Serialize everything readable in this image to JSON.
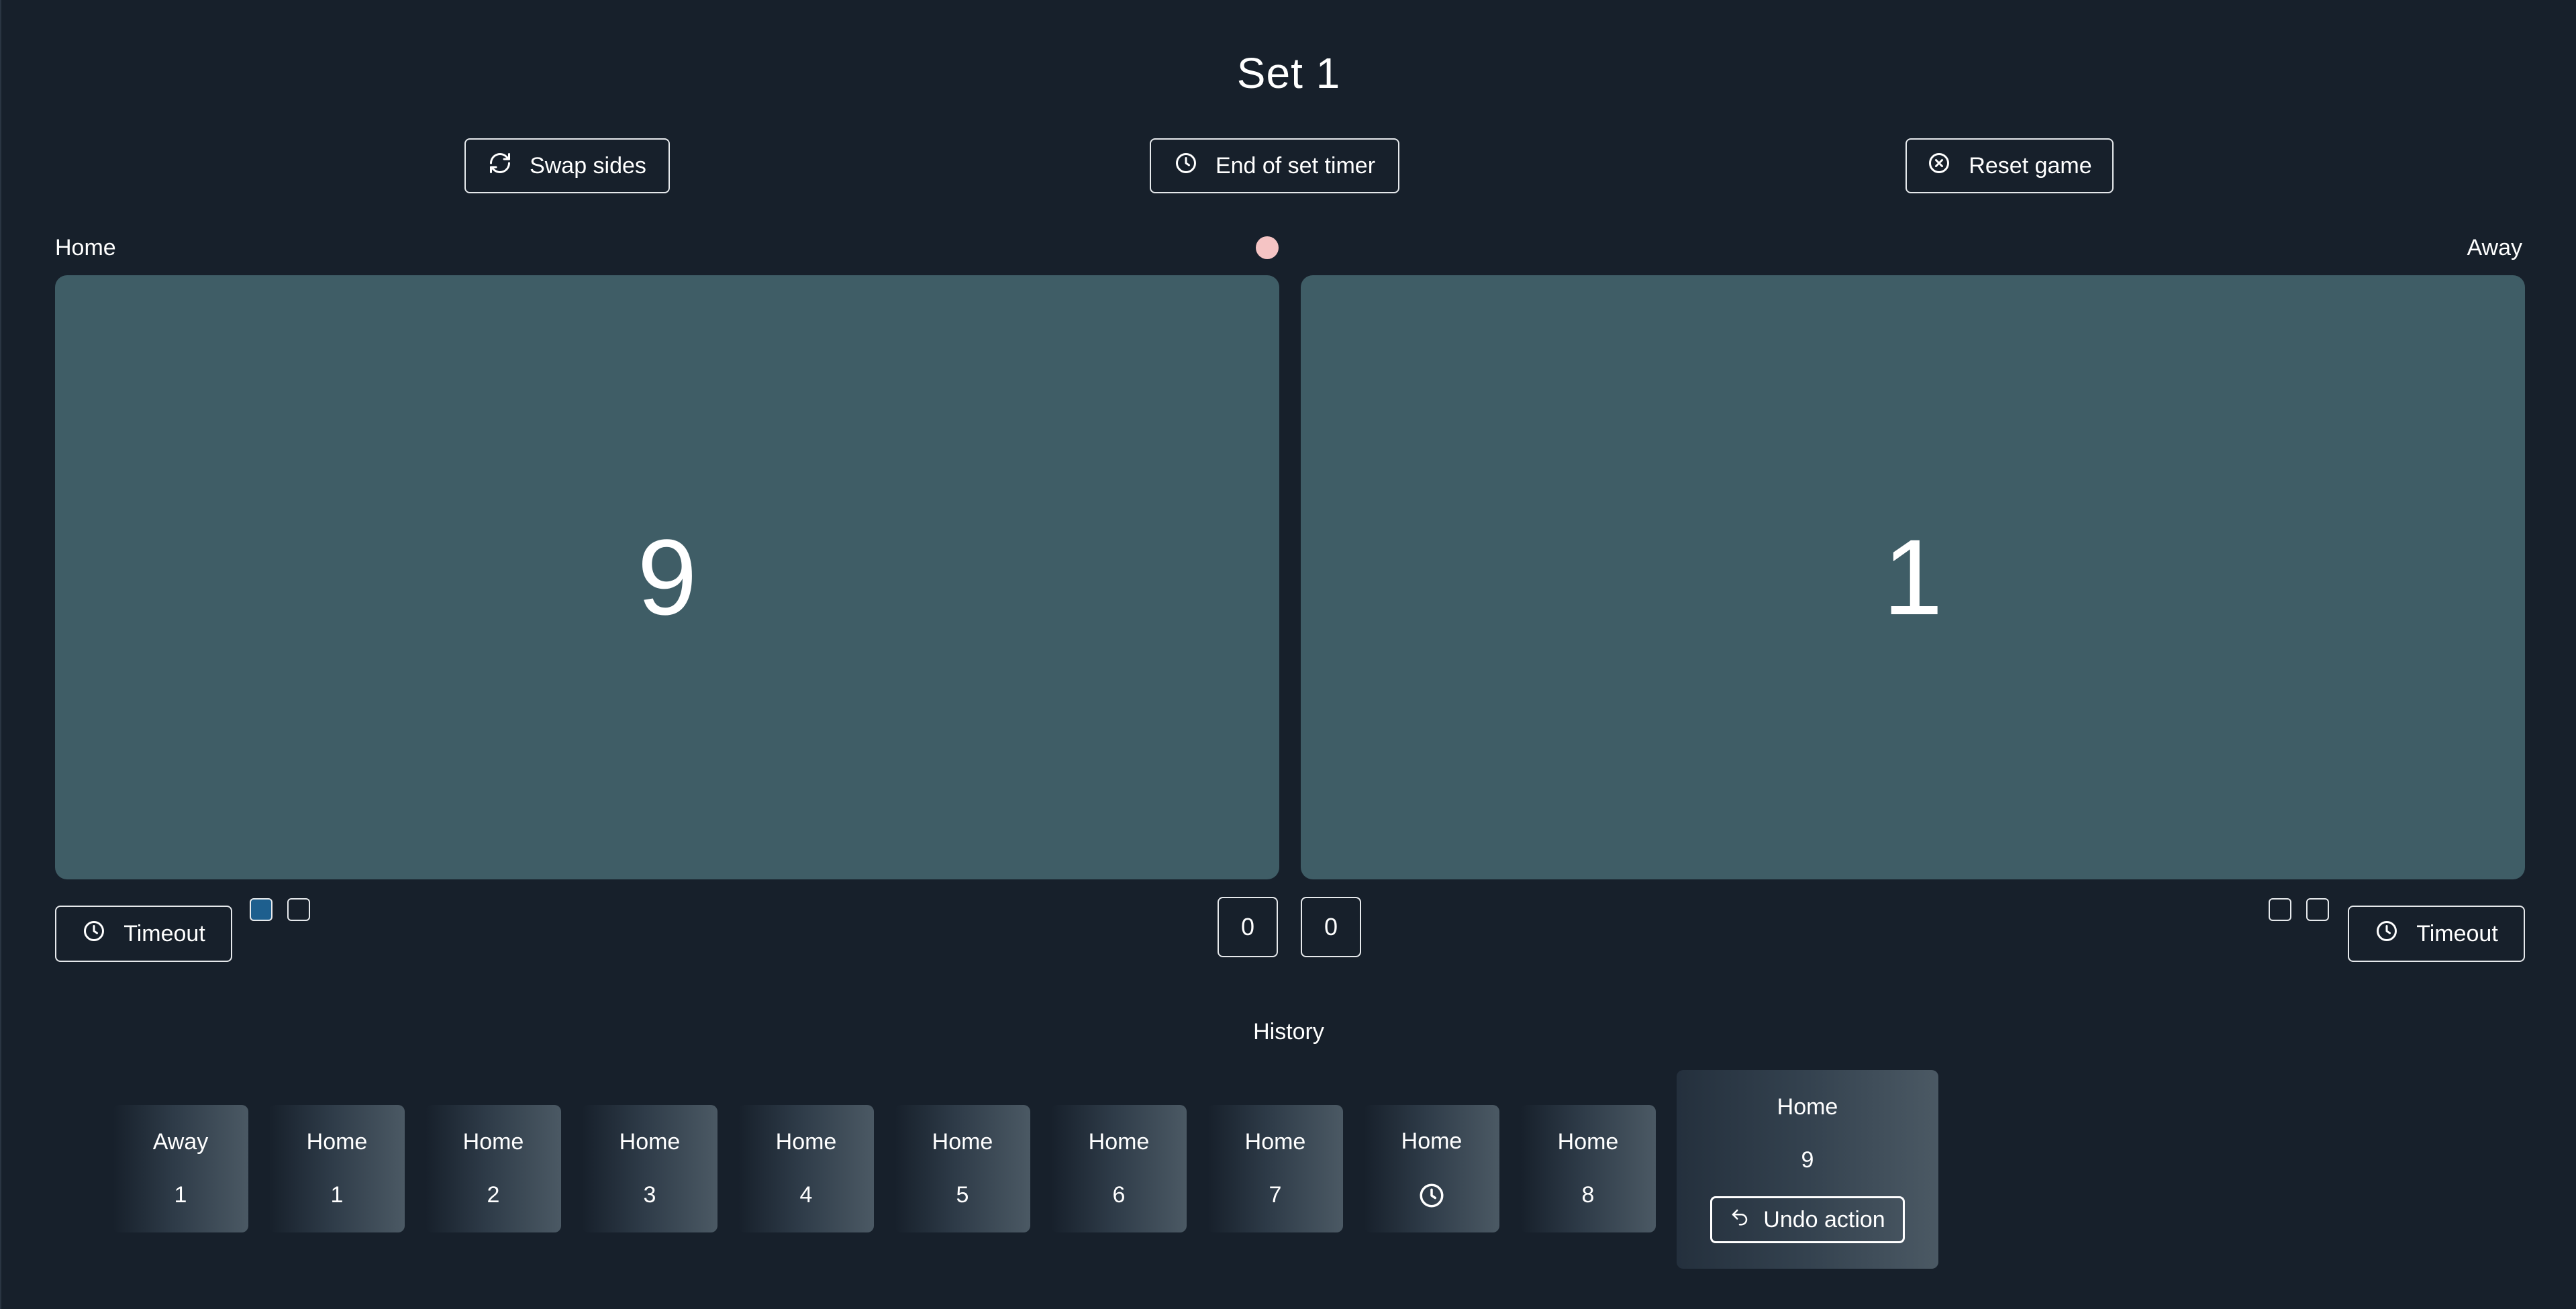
{
  "header": {
    "set_title": "Set 1"
  },
  "toolbar": {
    "swap_label": "Swap sides",
    "timer_label": "End of set timer",
    "reset_label": "Reset game"
  },
  "home": {
    "label": "Home",
    "score": "9",
    "sets_won": "0",
    "timeout_label": "Timeout",
    "timeouts_used": [
      true,
      false
    ]
  },
  "away": {
    "label": "Away",
    "score": "1",
    "sets_won": "0",
    "timeout_label": "Timeout",
    "timeouts_used": [
      false,
      false
    ]
  },
  "serve_indicator": {
    "color": "#f5c4c4"
  },
  "history": {
    "title": "History",
    "undo_label": "Undo action",
    "items": [
      {
        "team": "Away",
        "value": "1"
      },
      {
        "team": "Home",
        "value": "1"
      },
      {
        "team": "Home",
        "value": "2"
      },
      {
        "team": "Home",
        "value": "3"
      },
      {
        "team": "Home",
        "value": "4"
      },
      {
        "team": "Home",
        "value": "5"
      },
      {
        "team": "Home",
        "value": "6"
      },
      {
        "team": "Home",
        "value": "7"
      },
      {
        "team": "Home",
        "icon": "clock-icon"
      },
      {
        "team": "Home",
        "value": "8"
      },
      {
        "team": "Home",
        "value": "9"
      }
    ]
  },
  "colors": {
    "background": "#17202b",
    "score_panel": "#3f5d66",
    "timeout_used": "#1e5f8e"
  }
}
